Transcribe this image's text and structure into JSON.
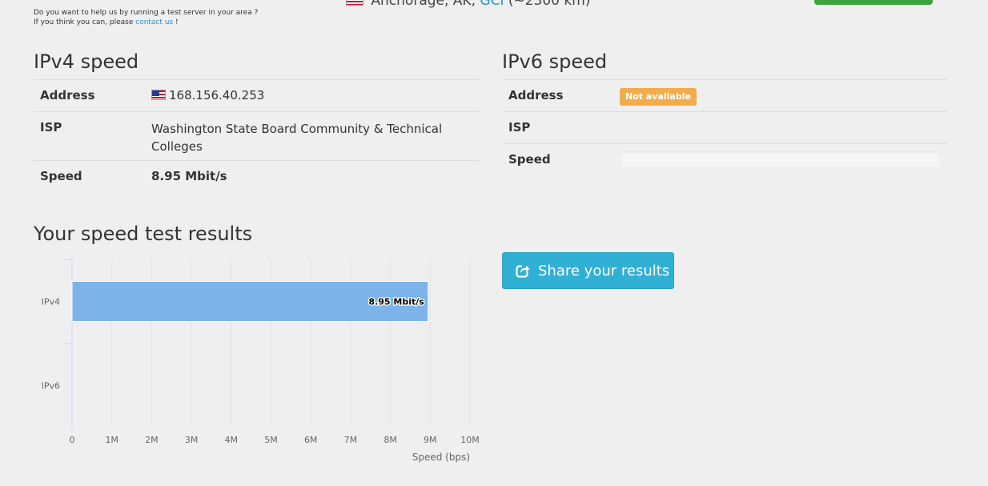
{
  "banner": {
    "help_line_1": "Do you want to help us by running a test server in your area ?",
    "help_line_2_prefix": "If you think you can, please ",
    "help_link": "contact us",
    "help_line_2_suffix": " !",
    "server_flag_code": "US",
    "server_city": "Anchorage, AK,",
    "server_isp": "GCI",
    "server_distance": "(~2300 km)"
  },
  "ipv4": {
    "heading": "IPv4 speed",
    "rows": [
      {
        "label": "Address",
        "value": "168.156.40.253"
      },
      {
        "label": "ISP",
        "value": "Washington State Board Community & Technical Colleges"
      },
      {
        "label": "Speed",
        "value": "8.95 Mbit/s"
      }
    ]
  },
  "ipv6": {
    "heading": "IPv6 speed",
    "rows": [
      {
        "label": "Address",
        "value": "Not available"
      },
      {
        "label": "ISP",
        "value": ""
      },
      {
        "label": "Speed",
        "value": ""
      }
    ]
  },
  "results": {
    "heading": "Your speed test results",
    "share_label": "Share your results"
  },
  "colors": {
    "bar": "#7cb4ea",
    "share_button": "#31b0d5",
    "badge": "#f0ad4e",
    "link": "#2a8fd6"
  },
  "chart_data": {
    "type": "bar",
    "orientation": "horizontal",
    "categories": [
      "IPv4",
      "IPv6"
    ],
    "values": [
      8950000,
      null
    ],
    "data_labels": [
      "8.95 Mbit/s",
      ""
    ],
    "xlabel": "Speed (bps)",
    "xlim": [
      0,
      10000000
    ],
    "xticks": [
      0,
      1000000,
      2000000,
      3000000,
      4000000,
      5000000,
      6000000,
      7000000,
      8000000,
      9000000,
      10000000
    ],
    "xtick_labels": [
      "0",
      "1M",
      "2M",
      "3M",
      "4M",
      "5M",
      "6M",
      "7M",
      "8M",
      "9M",
      "10M"
    ],
    "grid": true
  }
}
